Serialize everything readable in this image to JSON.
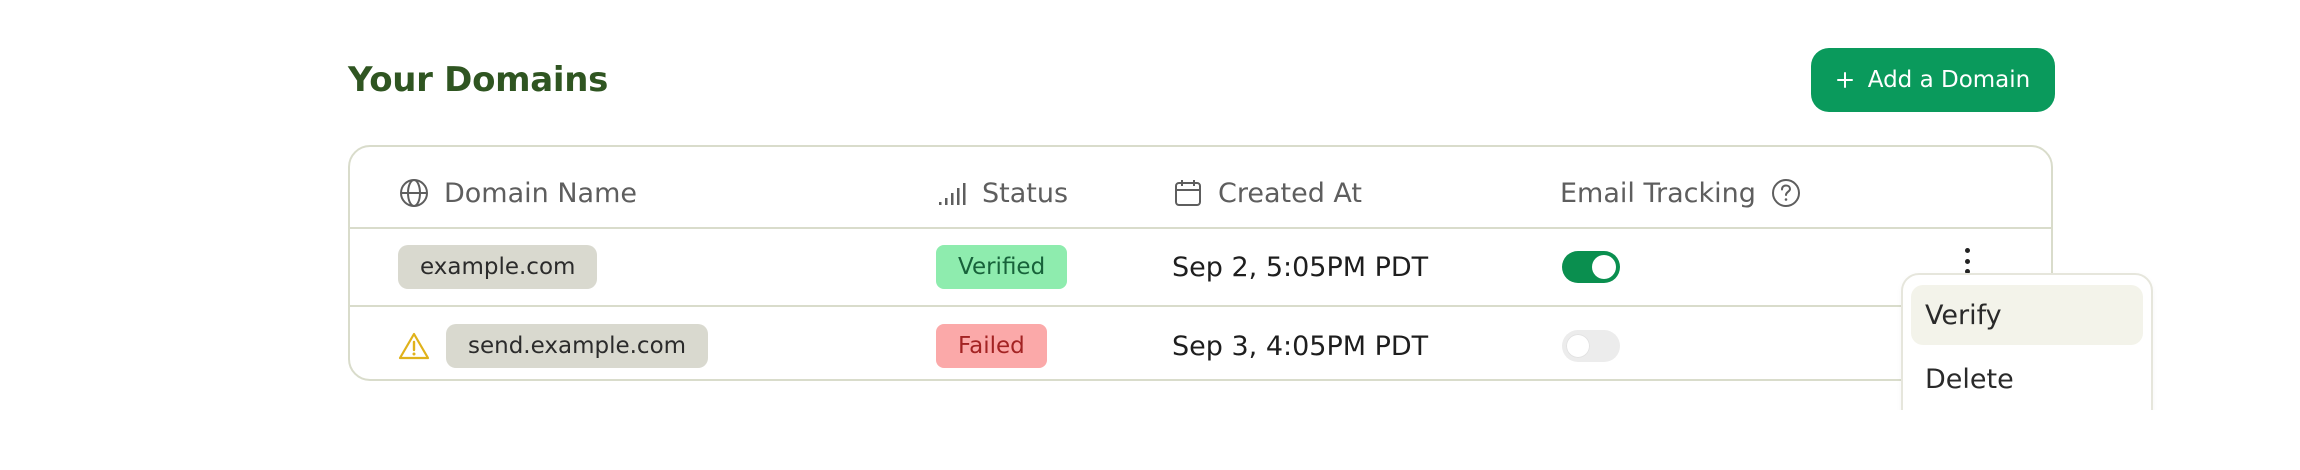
{
  "title": "Your Domains",
  "add_button": {
    "label": "Add a Domain",
    "icon": "plus-icon"
  },
  "columns": [
    {
      "label": "Domain Name",
      "icon": "globe-icon"
    },
    {
      "label": "Status",
      "icon": "signal-bars-icon"
    },
    {
      "label": "Created At",
      "icon": "calendar-icon"
    },
    {
      "label": "Email Tracking",
      "icon": "help-circle-icon"
    }
  ],
  "rows": [
    {
      "domain": "example.com",
      "warning": false,
      "status": "Verified",
      "created_at": "Sep 2, 5:05PM PDT",
      "email_tracking": true
    },
    {
      "domain": "send.example.com",
      "warning": true,
      "status": "Failed",
      "created_at": "Sep 3, 4:05PM PDT",
      "email_tracking": false
    }
  ],
  "row_menu": {
    "items": [
      "Verify",
      "Delete"
    ],
    "highlighted": "Verify"
  },
  "colors": {
    "brand": "#0a9a5c",
    "title": "#2f5521",
    "verified_bg": "#8eecae",
    "failed_bg": "#fba9a9",
    "warning": "#e0b21b",
    "toggle_on": "#0a8f4f"
  }
}
